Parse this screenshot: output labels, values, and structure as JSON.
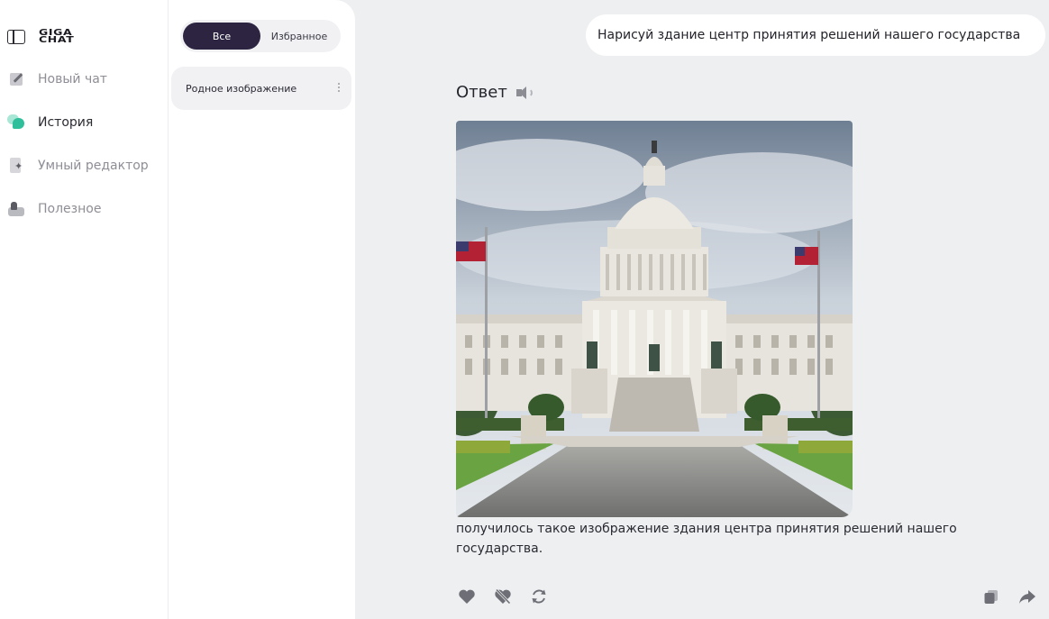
{
  "app": {
    "logo_line1": "GIGA",
    "logo_line2": "CHAT"
  },
  "nav": {
    "new_chat": "Новый чат",
    "history": "История",
    "smart_editor": "Умный редактор",
    "useful": "Полезное"
  },
  "filter": {
    "all": "Все",
    "favorites": "Избранное"
  },
  "history": {
    "items": [
      {
        "title": "Родное изображение"
      }
    ]
  },
  "chat": {
    "user_message": "Нарисуй здание центр принятия решений нашего государства",
    "answer_title": "Ответ",
    "answer_text": "получилось такое изображение здания центра принятия решений нашего государства."
  },
  "icons": {
    "toggle_sidebar": "sidebar-toggle-icon",
    "new_chat": "pencil-icon",
    "history": "chat-bubbles-icon",
    "smart_editor": "sparkle-document-icon",
    "useful": "toolbox-icon",
    "speaker": "speaker-icon",
    "like": "heart-icon",
    "dislike": "heart-off-icon",
    "regenerate": "refresh-icon",
    "copy": "copy-icon",
    "share": "share-arrow-icon"
  },
  "colors": {
    "accent_dark": "#2c2440",
    "history_green": "#2fbf9a",
    "background": "#eeeff1"
  }
}
